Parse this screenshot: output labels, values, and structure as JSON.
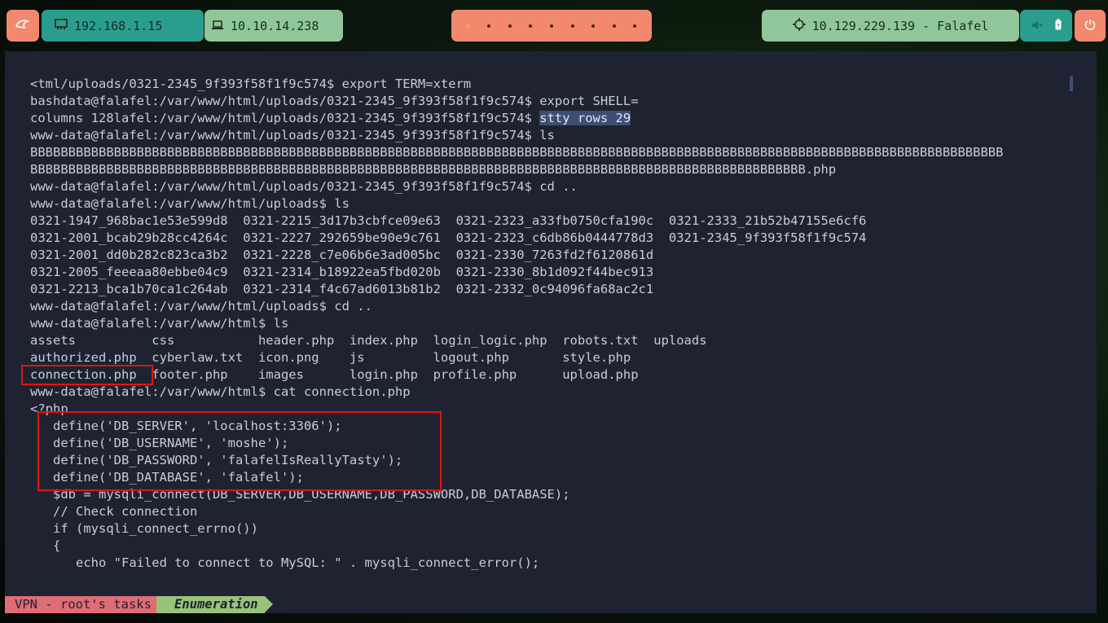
{
  "topbar": {
    "menu_icon": "penguin-icon",
    "ip1_icon": "network-card-icon",
    "ip1": "192.168.1.15",
    "ip2_icon": "laptop-icon",
    "ip2": "10.10.14.238",
    "workspaces_count": 9,
    "active_workspace_index": 0,
    "target_icon": "crosshair-icon",
    "target": "10.129.229.139 - Falafel",
    "sys_icons": [
      "mute-icon",
      "battery-icon"
    ],
    "power_icon": "power-icon"
  },
  "colors": {
    "terminal_bg": "#1e2231",
    "text": "#c9cdd8",
    "highlight_box": "#e01414",
    "pill_orange": "#f2896f",
    "pill_teal": "#2a9d8f",
    "pill_green": "#8fc79a"
  },
  "terminal": {
    "lines": [
      "<tml/uploads/0321-2345_9f393f58f1f9c574$ export TERM=xterm",
      "bashdata@falafel:/var/www/html/uploads/0321-2345_9f393f58f1f9c574$ export SHELL=",
      "columns 128lafel:/var/www/html/uploads/0321-2345_9f393f58f1f9c574$ ",
      "www-data@falafel:/var/www/html/uploads/0321-2345_9f393f58f1f9c574$ ls",
      "BBBBBBBBBBBBBBBBBBBBBBBBBBBBBBBBBBBBBBBBBBBBBBBBBBBBBBBBBBBBBBBBBBBBBBBBBBBBBBBBBBBBBBBBBBBBBBBBBBBBBBBBBBBBBBBBBBBBBBBBBBBBBBBB",
      "BBBBBBBBBBBBBBBBBBBBBBBBBBBBBBBBBBBBBBBBBBBBBBBBBBBBBBBBBBBBBBBBBBBBBBBBBBBBBBBBBBBBBBBBBBBBBBBBBBBBBB.php",
      "www-data@falafel:/var/www/html/uploads/0321-2345_9f393f58f1f9c574$ cd ..",
      "www-data@falafel:/var/www/html/uploads$ ls",
      "0321-1947_968bac1e53e599d8  0321-2215_3d17b3cbfce09e63  0321-2323_a33fb0750cfa190c  0321-2333_21b52b47155e6cf6",
      "0321-2001_bcab29b28cc4264c  0321-2227_292659be90e9c761  0321-2323_c6db86b0444778d3  0321-2345_9f393f58f1f9c574",
      "0321-2001_dd0b282c823ca3b2  0321-2228_c7e06b6e3ad005bc  0321-2330_7263fd2f6120861d",
      "0321-2005_feeeaa80ebbe04c9  0321-2314_b18922ea5fbd020b  0321-2330_8b1d092f44bec913",
      "0321-2213_bca1b70ca1c264ab  0321-2314_f4c67ad6013b81b2  0321-2332_0c94096fa68ac2c1",
      "www-data@falafel:/var/www/html/uploads$ cd ..",
      "www-data@falafel:/var/www/html$ ls",
      "assets          css           header.php  index.php  login_logic.php  robots.txt  uploads",
      "authorized.php  cyberlaw.txt  icon.png    js         logout.php       style.php",
      "connection.php  footer.php    images      login.php  profile.php      upload.php",
      "www-data@falafel:/var/www/html$ cat connection.php",
      "<?php",
      "   define('DB_SERVER', 'localhost:3306');",
      "   define('DB_USERNAME', 'moshe');",
      "   define('DB_PASSWORD', 'falafelIsReallyTasty');",
      "   define('DB_DATABASE', 'falafel');",
      "   $db = mysqli_connect(DB_SERVER,DB_USERNAME,DB_PASSWORD,DB_DATABASE);",
      "   // Check connection",
      "   if (mysqli_connect_errno())",
      "   {",
      "      echo \"Failed to connect to MySQL: \" . mysqli_connect_error();"
    ],
    "selected_text": "stty rows 29"
  },
  "statusbar": {
    "session": "VPN - root's tasks",
    "window": "Enumeration"
  }
}
